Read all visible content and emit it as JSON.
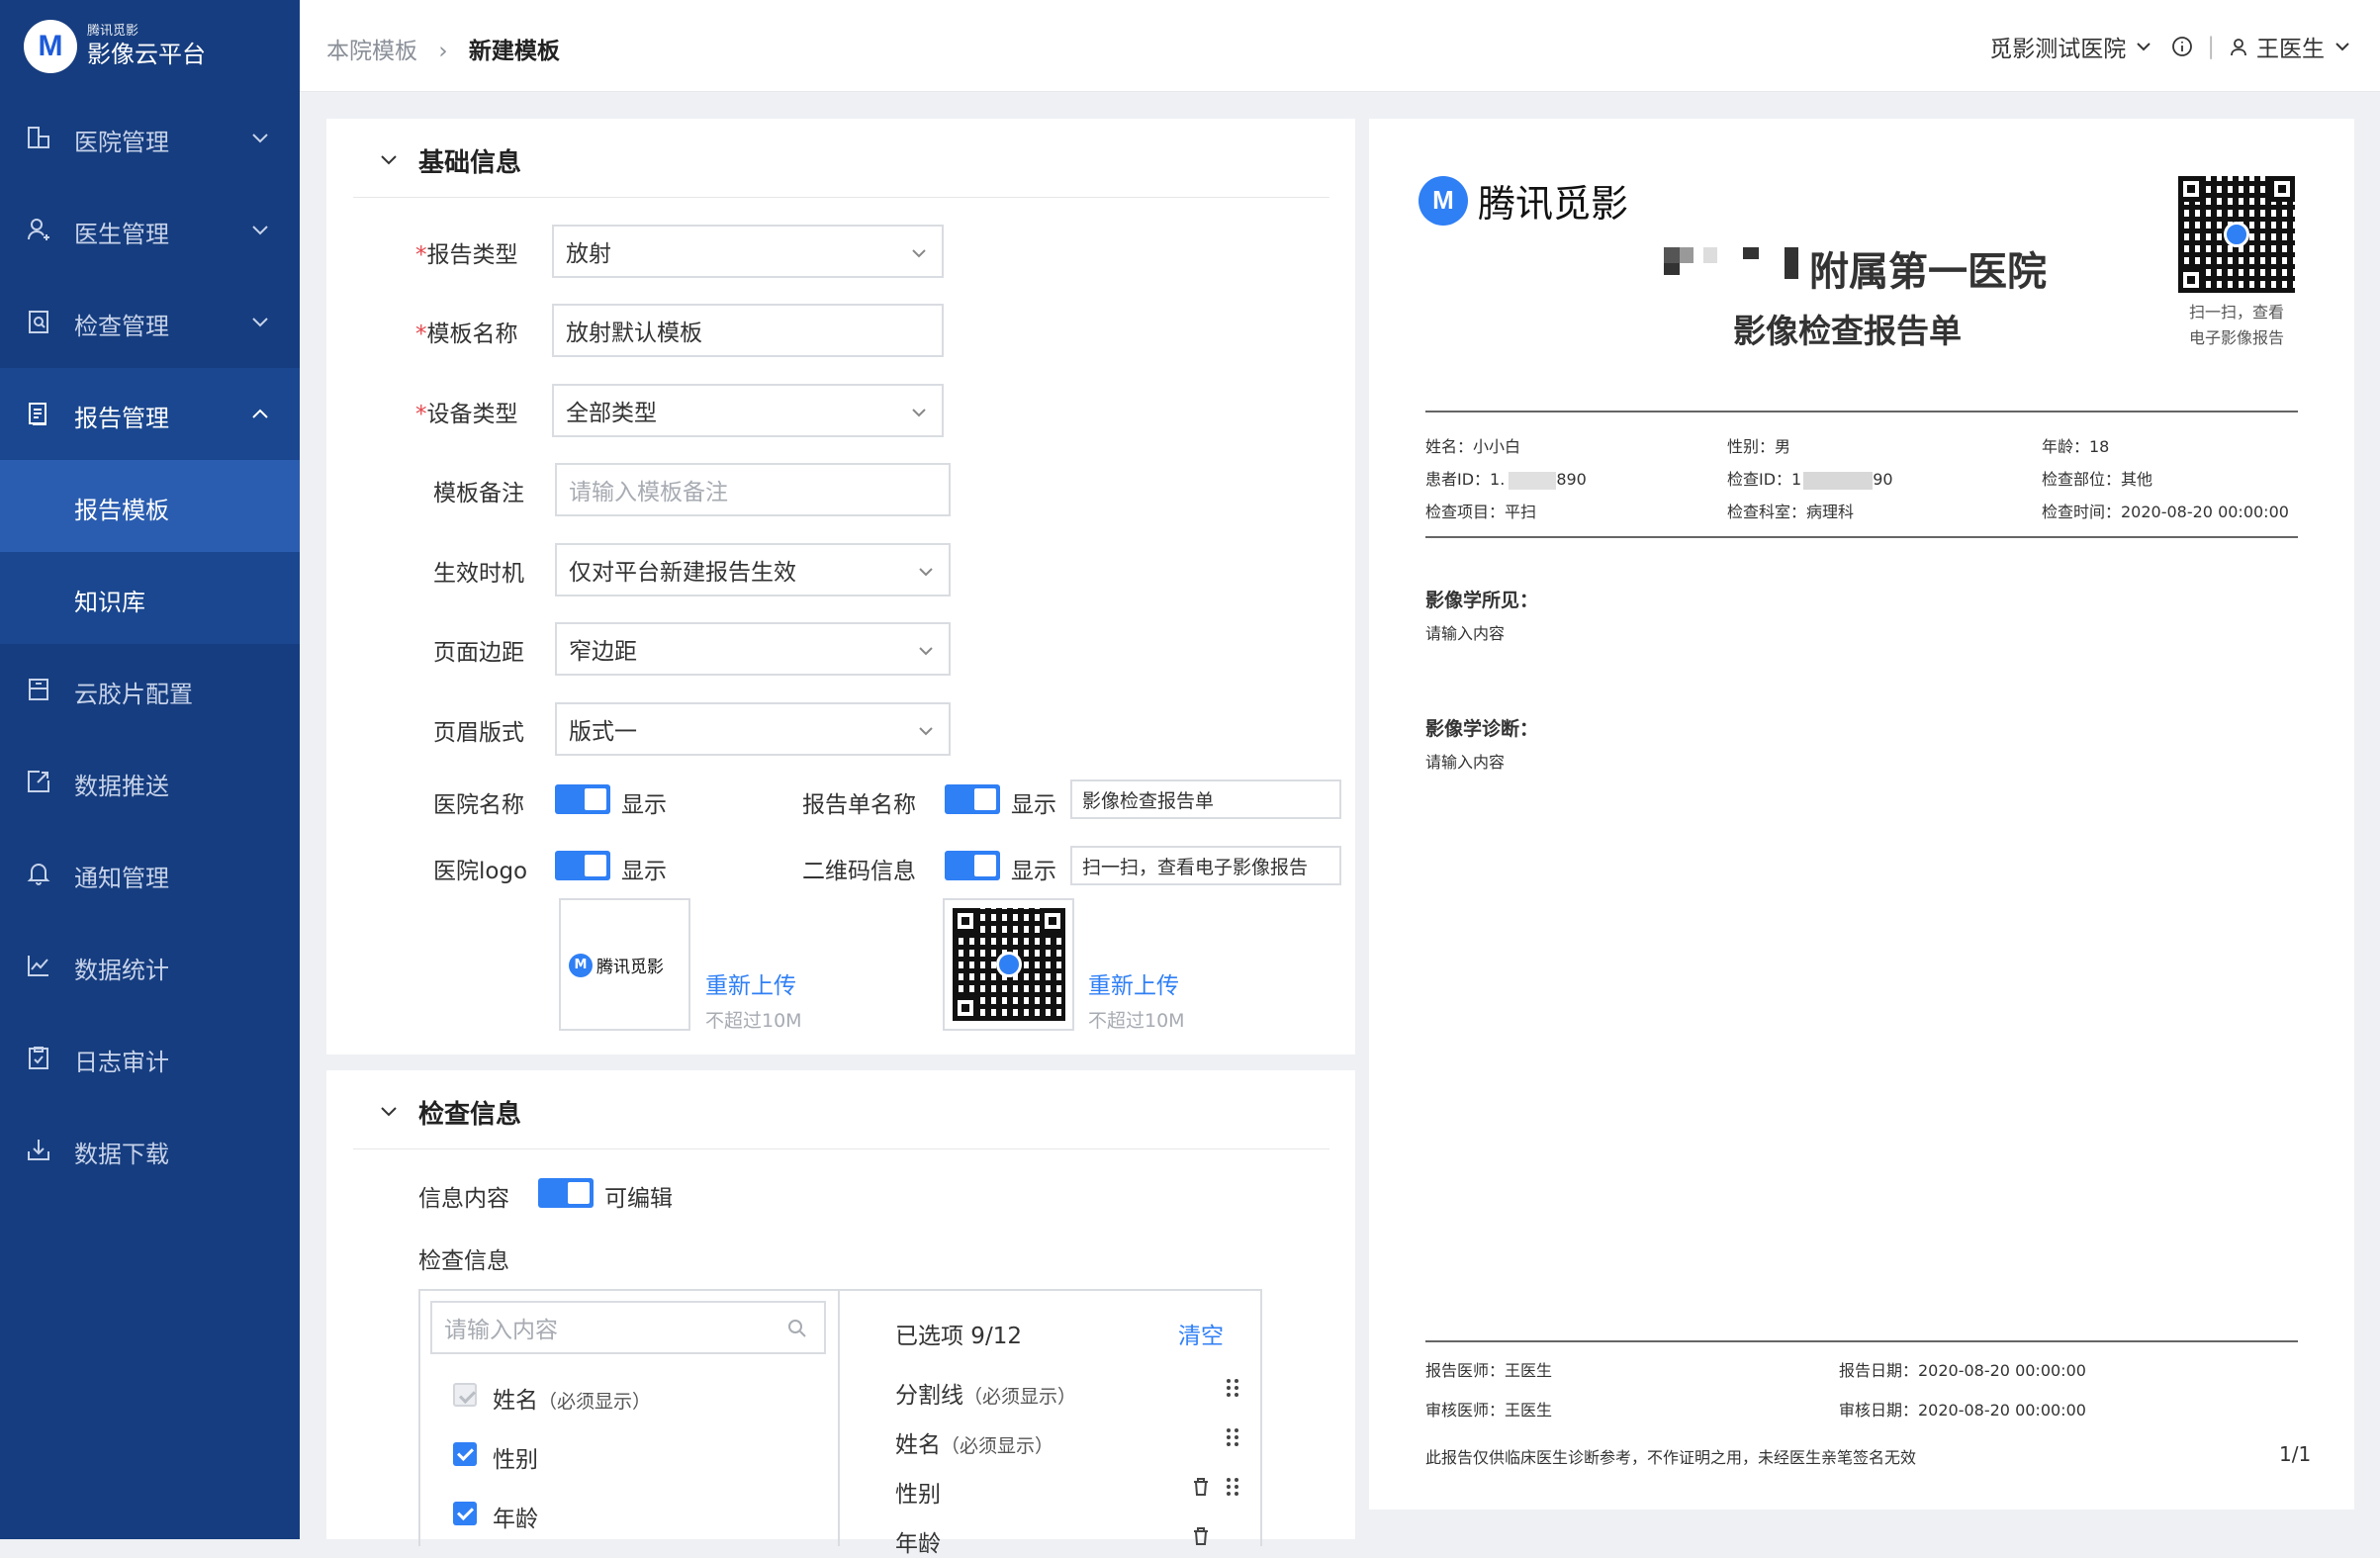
{
  "sidebar": {
    "logo_small": "腾讯觅影",
    "logo_big": "影像云平台",
    "items": [
      {
        "label": "医院管理",
        "icon": "hospital-icon"
      },
      {
        "label": "医生管理",
        "icon": "doctor-icon"
      },
      {
        "label": "检查管理",
        "icon": "exam-icon"
      },
      {
        "label": "报告管理",
        "icon": "report-icon"
      },
      {
        "label": "报告模板"
      },
      {
        "label": "知识库"
      },
      {
        "label": "云胶片配置",
        "icon": "film-icon"
      },
      {
        "label": "数据推送",
        "icon": "push-icon"
      },
      {
        "label": "通知管理",
        "icon": "bell-icon"
      },
      {
        "label": "数据统计",
        "icon": "chart-icon"
      },
      {
        "label": "日志审计",
        "icon": "audit-icon"
      },
      {
        "label": "数据下载",
        "icon": "download-icon"
      }
    ]
  },
  "header": {
    "breadcrumb_parent": "本院模板",
    "breadcrumb_current": "新建模板",
    "hospital": "觅影测试医院",
    "user": "王医生"
  },
  "basic": {
    "title": "基础信息",
    "report_type_label": "报告类型",
    "report_type": "放射",
    "template_name_label": "模板名称",
    "template_name": "放射默认模板",
    "device_type_label": "设备类型",
    "device_type": "全部类型",
    "remark_label": "模板备注",
    "remark_placeholder": "请输入模板备注",
    "effective_label": "生效时机",
    "effective": "仅对平台新建报告生效",
    "margin_label": "页面边距",
    "margin": "窄边距",
    "header_style_label": "页眉版式",
    "header_style": "版式一",
    "hospital_name_label": "医院名称",
    "show": "显示",
    "report_name_label": "报告单名称",
    "report_name_value": "影像检查报告单",
    "hospital_logo_label": "医院logo",
    "qr_label": "二维码信息",
    "qr_value": "扫一扫，查看电子影像报告",
    "logo_preview_text": "腾讯觅影",
    "reupload": "重新上传",
    "size_hint": "不超过10M"
  },
  "exam": {
    "title": "检查信息",
    "info_content_label": "信息内容",
    "editable": "可编辑",
    "exam_info_label": "检查信息",
    "search_placeholder": "请输入内容",
    "left_items": [
      {
        "label": "姓名",
        "note": "（必须显示）",
        "disabled": true
      },
      {
        "label": "性别",
        "note": ""
      },
      {
        "label": "年龄",
        "note": ""
      }
    ],
    "selected_count": "已选项 9/12",
    "clear": "清空",
    "right_items": [
      {
        "label": "分割线",
        "note": "（必须显示）"
      },
      {
        "label": "姓名",
        "note": "（必须显示）"
      },
      {
        "label": "性别",
        "note": ""
      },
      {
        "label": "年龄",
        "note": ""
      }
    ]
  },
  "report": {
    "brand": "腾讯觅影",
    "hospital": "附属第一医院",
    "title": "影像检查报告单",
    "qr_caption_1": "扫一扫，查看",
    "qr_caption_2": "电子影像报告",
    "name": "姓名：小小白",
    "gender": "性别：男",
    "age": "年龄：18",
    "patient_id_a": "患者ID：1.",
    "patient_id_b": "890",
    "exam_id_a": "检查ID：1",
    "exam_id_b": "90",
    "exam_part": "检查部位：其他",
    "exam_item": "检查项目：平扫",
    "exam_dept": "检查科室：病理科",
    "exam_time": "检查时间：2020-08-20  00:00:00",
    "findings_title": "影像学所见：",
    "findings_ph": "请输入内容",
    "diagnosis_title": "影像学诊断：",
    "diagnosis_ph": "请输入内容",
    "report_doctor": "报告医师：王医生",
    "report_date": "报告日期：2020-08-20  00:00:00",
    "review_doctor": "审核医师：王医生",
    "review_date": "审核日期：2020-08-20  00:00:00",
    "disclaimer": "此报告仅供临床医生诊断参考，不作证明之用，未经医生亲笔签名无效",
    "page": "1/1"
  },
  "colors": {
    "sidebar": "#163d7f",
    "accent": "#2f7ff5"
  }
}
